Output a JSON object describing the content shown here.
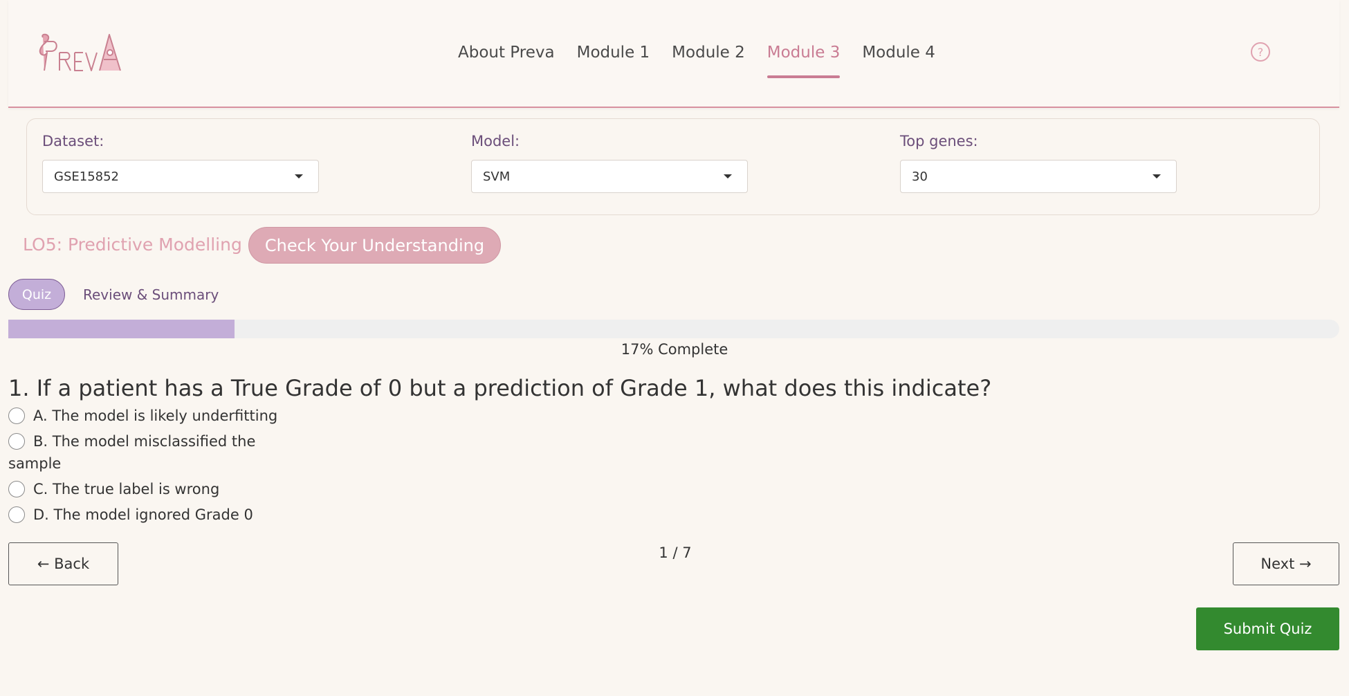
{
  "header": {
    "logo_text": "PREVA",
    "nav": [
      {
        "label": "About Preva",
        "active": false
      },
      {
        "label": "Module 1",
        "active": false
      },
      {
        "label": "Module 2",
        "active": false
      },
      {
        "label": "Module 3",
        "active": true
      },
      {
        "label": "Module 4",
        "active": false
      }
    ],
    "help_icon": "question-circle-icon"
  },
  "controls": {
    "dataset": {
      "label": "Dataset:",
      "value": "GSE15852"
    },
    "model": {
      "label": "Model:",
      "value": "SVM"
    },
    "top_genes": {
      "label": "Top genes:",
      "value": "30"
    }
  },
  "section": {
    "title": "LO5: Predictive Modelling",
    "check_button": "Check Your Understanding"
  },
  "tabs": {
    "quiz": "Quiz",
    "review": "Review & Summary"
  },
  "progress": {
    "percent": 17,
    "text": "17% Complete"
  },
  "question": {
    "text": "1. If a patient has a True Grade of 0 but a prediction of Grade 1, what does this indicate?",
    "options": [
      "A. The model is likely underfitting",
      "B. The model misclassified the sample",
      "C. The true label is wrong",
      "D. The model ignored Grade 0"
    ]
  },
  "navigation": {
    "back_label": "← Back",
    "next_label": "Next →",
    "counter": "1 / 7",
    "submit_label": "Submit Quiz"
  },
  "colors": {
    "accent_pink": "#c97c93",
    "quiz_purple": "#c3aed8",
    "submit_green": "#338a2f"
  }
}
